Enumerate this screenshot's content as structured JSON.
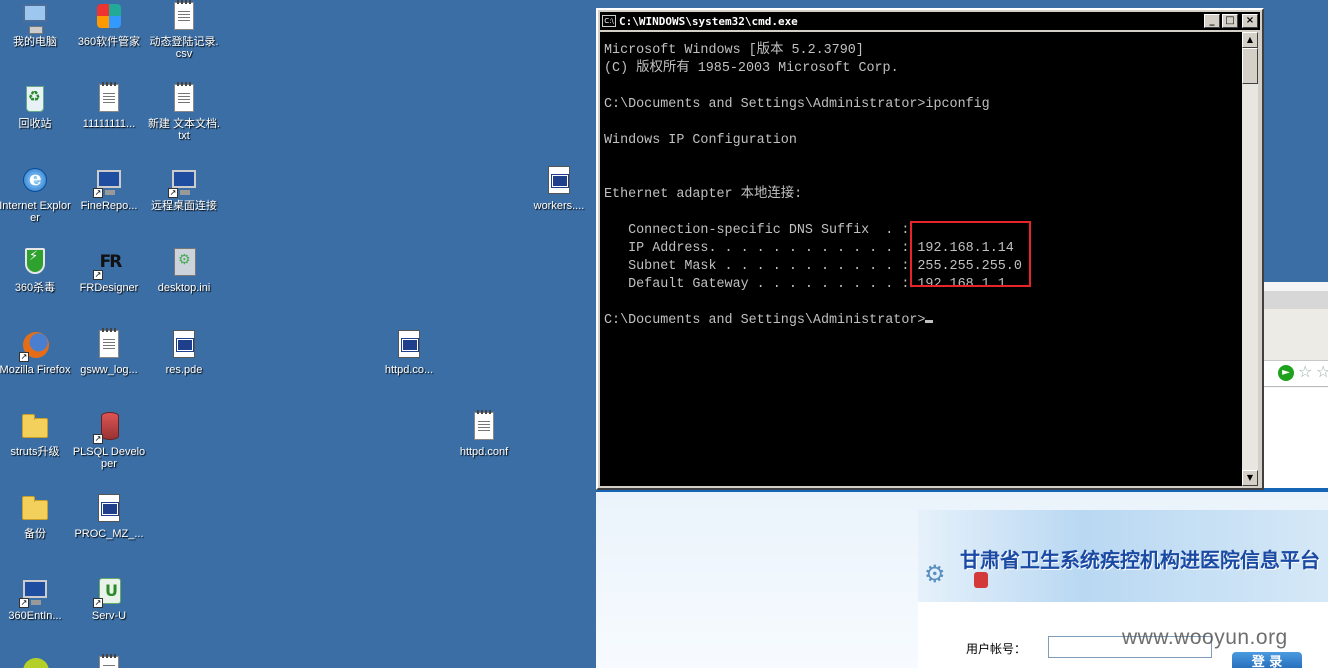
{
  "desktop": {
    "icons": [
      {
        "label": "我的电脑",
        "icon": "my-computer-icon"
      },
      {
        "label": "360软件管家",
        "icon": "360-software-manager-icon"
      },
      {
        "label": "动态登陆记录.csv",
        "icon": "csv-file-icon"
      },
      {
        "label": "回收站",
        "icon": "recycle-bin-icon"
      },
      {
        "label": "11111111...",
        "icon": "text-file-icon"
      },
      {
        "label": "新建 文本文档.txt",
        "icon": "text-file-icon"
      },
      {
        "label": "Internet Explorer",
        "icon": "internet-explorer-icon"
      },
      {
        "label": "FineRepo...",
        "icon": "finereport-icon"
      },
      {
        "label": "远程桌面连接",
        "icon": "remote-desktop-icon"
      },
      {
        "label": "workers....",
        "icon": "properties-file-icon"
      },
      {
        "label": "360杀毒",
        "icon": "360-antivirus-icon"
      },
      {
        "label": "FRDesigner",
        "icon": "frdesigner-icon"
      },
      {
        "label": "desktop.ini",
        "icon": "ini-file-icon"
      },
      {
        "label": "Mozilla Firefox",
        "icon": "firefox-icon"
      },
      {
        "label": "gsww_log...",
        "icon": "text-file-icon"
      },
      {
        "label": "res.pde",
        "icon": "config-file-icon"
      },
      {
        "label": "httpd.co...",
        "icon": "config-file-icon"
      },
      {
        "label": "struts升级",
        "icon": "folder-icon"
      },
      {
        "label": "PLSQL Developer",
        "icon": "plsql-developer-icon"
      },
      {
        "label": "httpd.conf",
        "icon": "text-file-icon"
      },
      {
        "label": "备份",
        "icon": "folder-icon"
      },
      {
        "label": "PROC_MZ_...",
        "icon": "config-file-icon"
      },
      {
        "label": "360EntIn...",
        "icon": "360-enterprise-icon"
      },
      {
        "label": "Serv-U",
        "icon": "serv-u-icon"
      }
    ]
  },
  "cmd": {
    "title": "C:\\WINDOWS\\system32\\cmd.exe",
    "controls": {
      "minimize": "_",
      "maximize": "□",
      "close": "×"
    },
    "lines": [
      "Microsoft Windows [版本 5.2.3790]",
      "(C) 版权所有 1985-2003 Microsoft Corp.",
      "",
      "C:\\Documents and Settings\\Administrator>ipconfig",
      "",
      "Windows IP Configuration",
      "",
      "",
      "Ethernet adapter 本地连接:",
      "",
      "   Connection-specific DNS Suffix  . :",
      "   IP Address. . . . . . . . . . . . : 192.168.1.14",
      "   Subnet Mask . . . . . . . . . . . : 255.255.255.0",
      "   Default Gateway . . . . . . . . . : 192.168.1.1",
      "",
      "C:\\Documents and Settings\\Administrator>"
    ],
    "highlight_color": "#e8242a"
  },
  "portal": {
    "title": "甘肃省卫生系统疾控机构进医院信息平台",
    "username_label": "用户帐号：",
    "username_value": "",
    "login_button": "登 录"
  },
  "watermark": "www.wooyun.org",
  "colors": {
    "desktop_bg": "#3a6ea5",
    "console_bg": "#000000",
    "console_text": "#c0c0c0",
    "banner_text": "#1a4aa3"
  }
}
